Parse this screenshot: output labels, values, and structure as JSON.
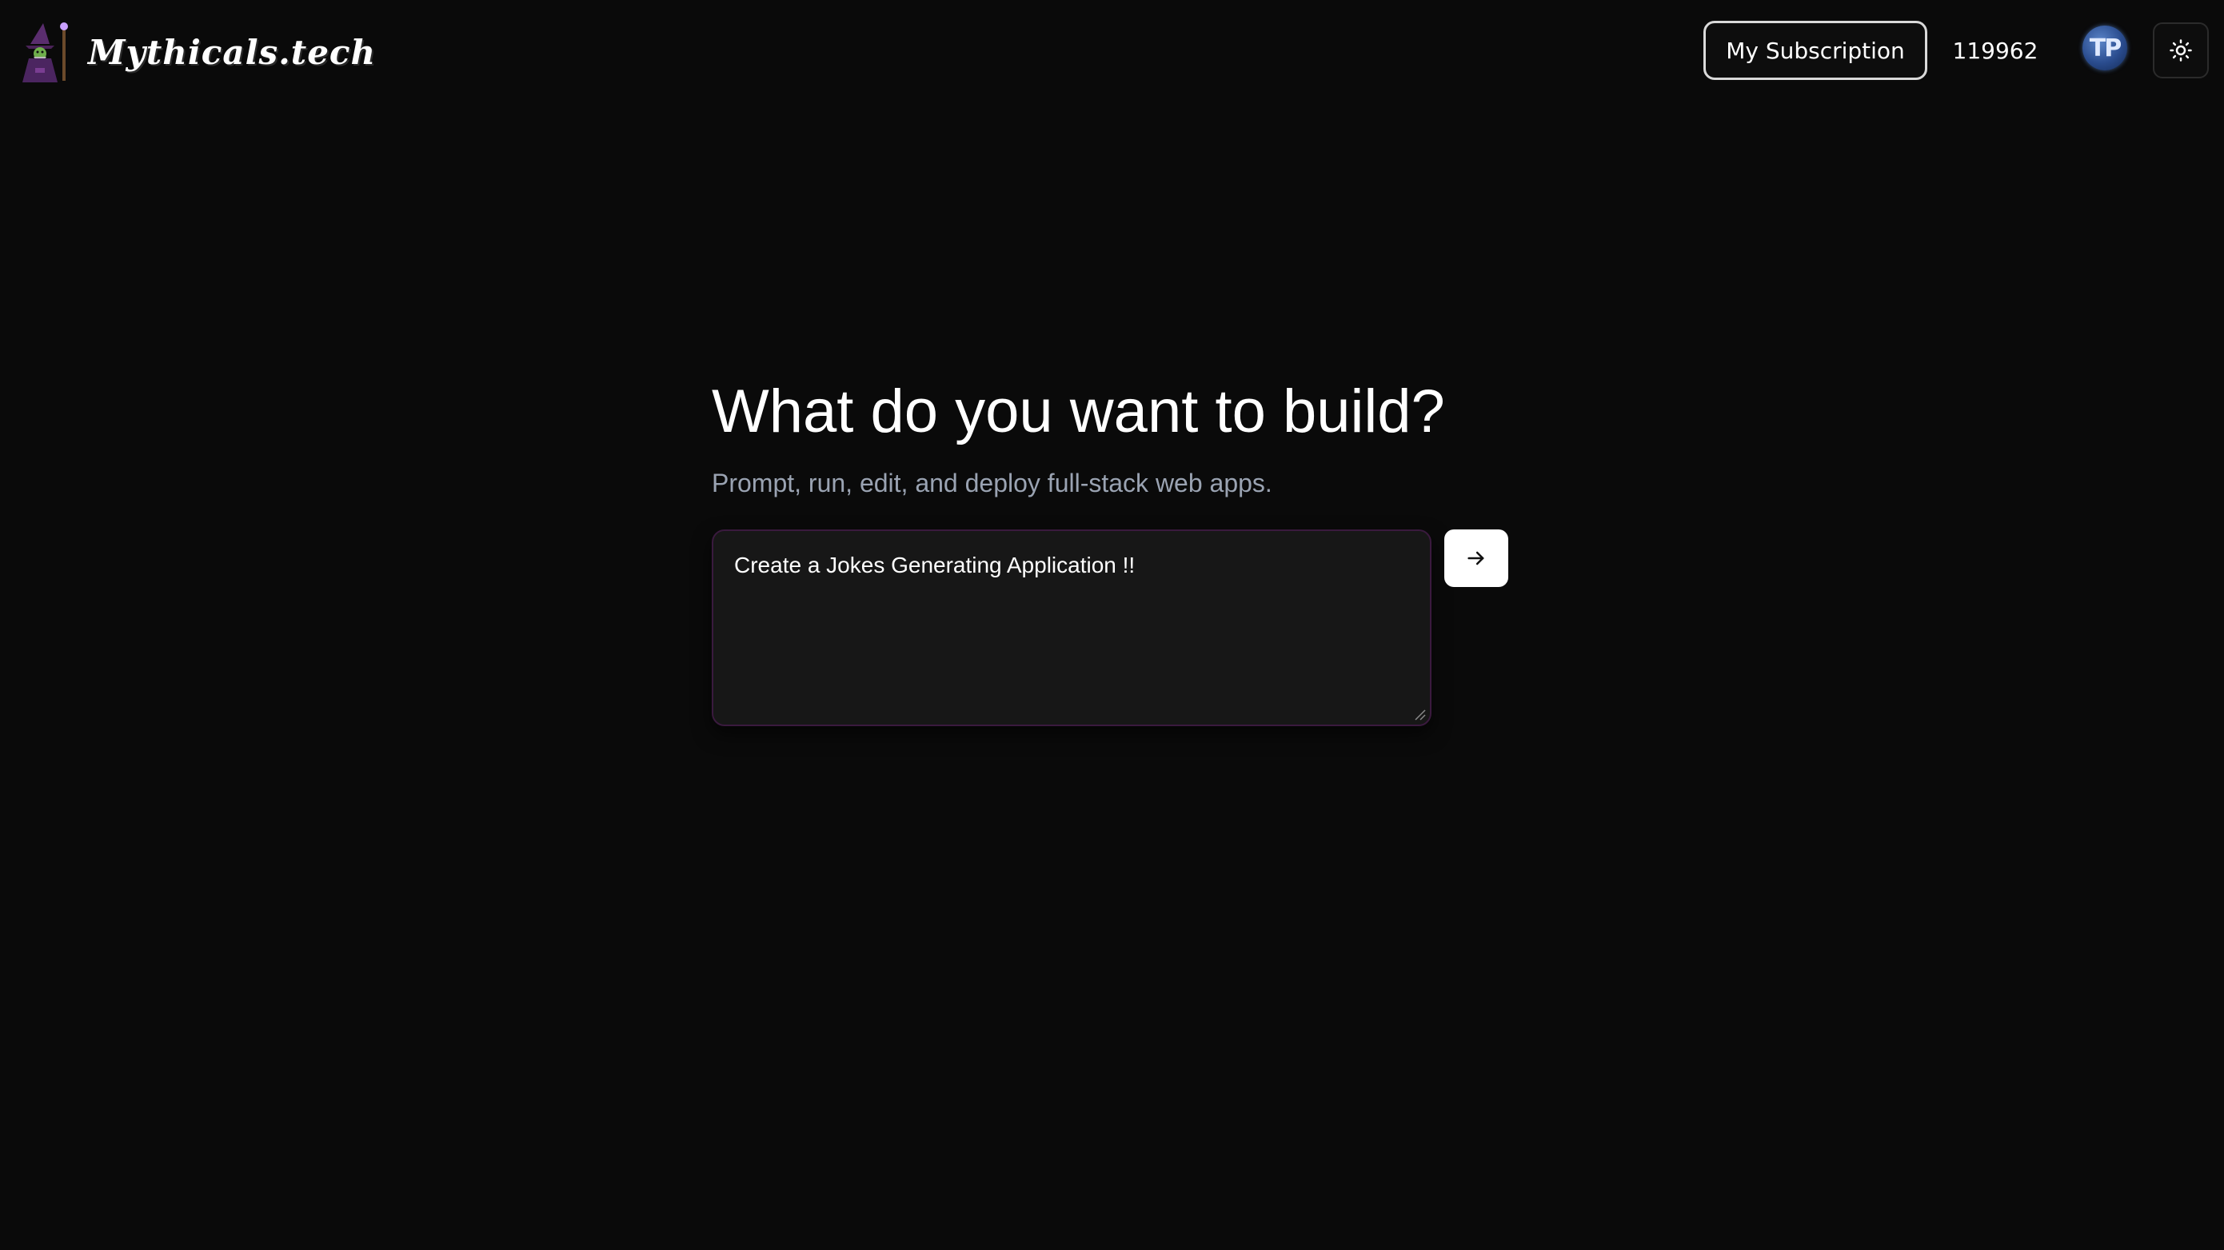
{
  "header": {
    "logo_text": "Mythicals.tech",
    "logo_icon": "wizard-icon",
    "subscription_label": "My Subscription",
    "credits": "119962",
    "avatar_initials": "TP",
    "theme_icon": "sun-icon"
  },
  "main": {
    "title": "What do you want to build?",
    "subtitle": "Prompt, run, edit, and deploy full-stack web apps.",
    "prompt_value": "Create a Jokes Generating Application !!",
    "send_icon": "arrow-right-icon"
  },
  "colors": {
    "background": "#0a0a0a",
    "input_background": "#171717",
    "input_border": "#3a1a3e",
    "subtitle": "#9aa3b2",
    "button_background": "#ffffff"
  }
}
